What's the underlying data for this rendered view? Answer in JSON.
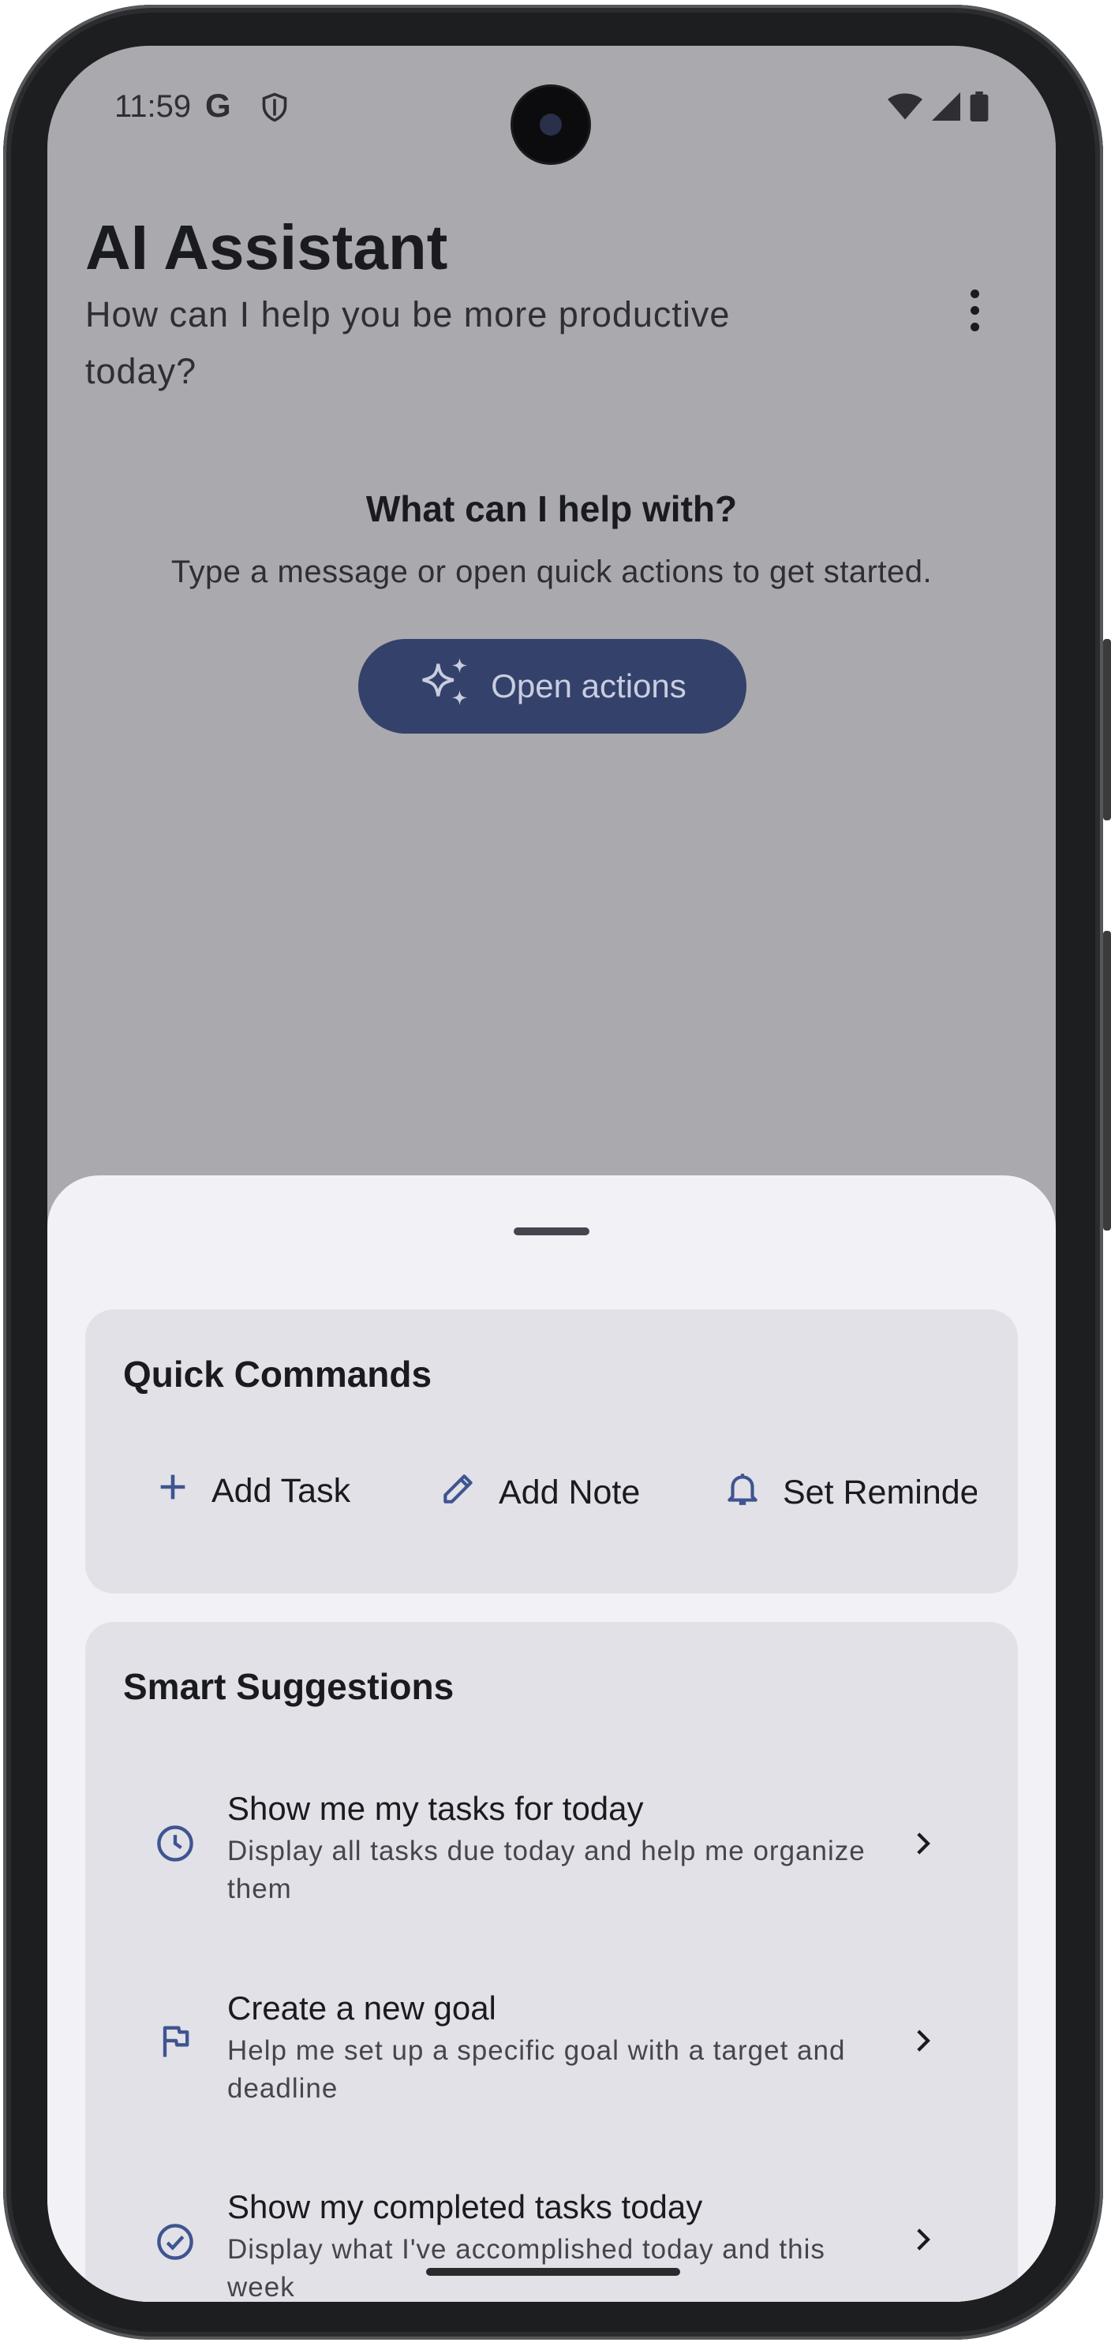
{
  "status_bar": {
    "time": "11:59",
    "google_icon": "G",
    "icons_left": [
      "google-icon",
      "shield-icon"
    ],
    "icons_right": [
      "wifi-icon",
      "signal-icon",
      "battery-icon"
    ]
  },
  "header": {
    "title": "AI Assistant",
    "subtitle": "How can I help you be more productive today?",
    "menu_icon": "more-vert-icon"
  },
  "empty_state": {
    "title": "What can I help with?",
    "description": "Type a message or open quick actions to get started.",
    "button_label": "Open actions",
    "button_icon": "sparkles-icon"
  },
  "colors": {
    "accent": "#34426b",
    "scrim_background": "#aaa9ad",
    "sheet_background": "#f2f1f6",
    "card_background": "#e2e1e7",
    "icon_blue": "#3f5591"
  },
  "quick_commands": {
    "title": "Quick Commands",
    "items": [
      {
        "label": "Add Task",
        "icon": "plus-icon"
      },
      {
        "label": "Add Note",
        "icon": "pencil-icon"
      },
      {
        "label": "Set Reminder",
        "icon": "bell-icon"
      }
    ]
  },
  "smart_suggestions": {
    "title": "Smart Suggestions",
    "items": [
      {
        "title": "Show me my tasks for today",
        "description": "Display all tasks due today and help me organize them",
        "icon": "clock-icon"
      },
      {
        "title": "Create a new goal",
        "description": "Help me set up a specific goal with a target and deadline",
        "icon": "flag-icon"
      },
      {
        "title": "Show my completed tasks today",
        "description": "Display what I've accomplished today and this week",
        "icon": "check-circle-icon"
      }
    ]
  }
}
